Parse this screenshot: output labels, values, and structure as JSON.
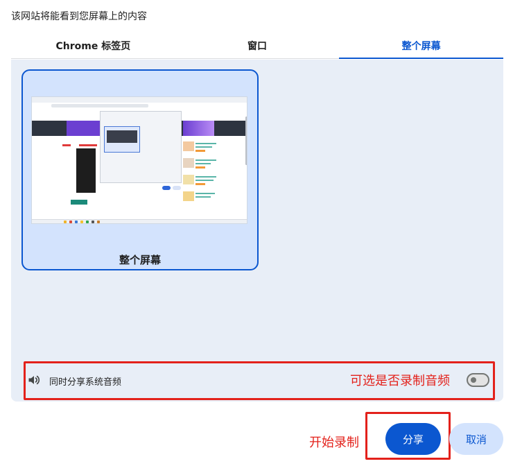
{
  "prompt": "该网站将能看到您屏幕上的内容",
  "tabs": [
    {
      "label": "Chrome 标签页",
      "active": false
    },
    {
      "label": "窗口",
      "active": false
    },
    {
      "label": "整个屏幕",
      "active": true
    }
  ],
  "sources": [
    {
      "label": "整个屏幕",
      "selected": true
    }
  ],
  "audio": {
    "label": "同时分享系统音频",
    "enabled": false,
    "icon": "speaker-icon"
  },
  "annotations": {
    "audio_note": "可选是否录制音频",
    "start_note": "开始录制"
  },
  "buttons": {
    "share": "分享",
    "cancel": "取消"
  },
  "colors": {
    "accent": "#0b57d0",
    "annotation": "#e3211b",
    "panel_bg": "#e8eef7",
    "selected_card_bg": "#d3e3fd"
  }
}
